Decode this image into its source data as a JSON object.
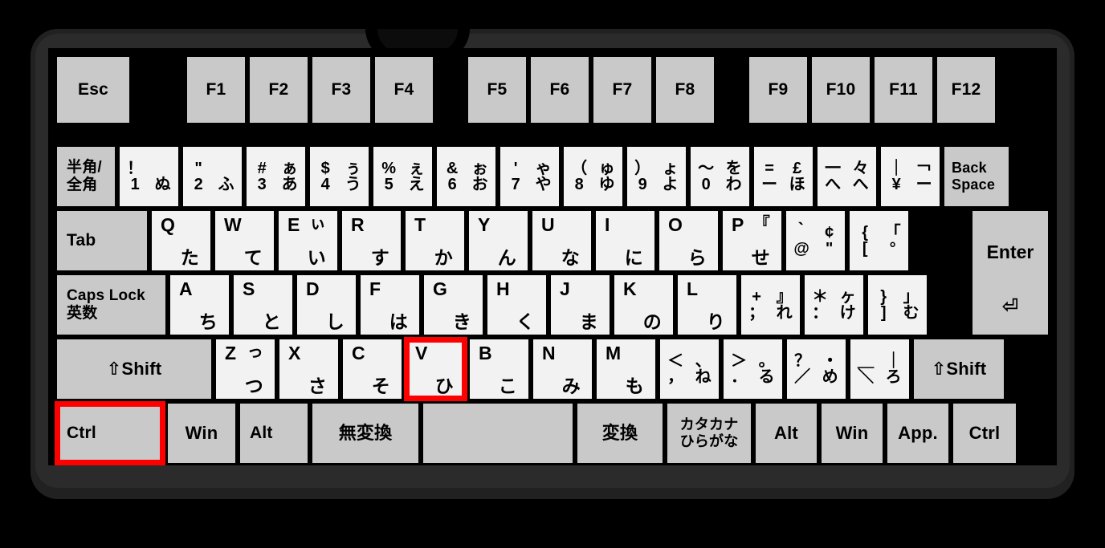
{
  "device": {
    "name": "japanese-jis-keyboard",
    "body_color": "#2b2b2b",
    "key_color": "#c9c9c9",
    "alpha_key_color": "#f2f2f2",
    "highlight_color": "#ff0000"
  },
  "highlighted_keys": [
    "Ctrl",
    "V"
  ],
  "rows": {
    "function_row": [
      {
        "id": "esc",
        "label": "Esc"
      },
      {
        "id": "f1",
        "label": "F1"
      },
      {
        "id": "f2",
        "label": "F2"
      },
      {
        "id": "f3",
        "label": "F3"
      },
      {
        "id": "f4",
        "label": "F4"
      },
      {
        "id": "f5",
        "label": "F5"
      },
      {
        "id": "f6",
        "label": "F6"
      },
      {
        "id": "f7",
        "label": "F7"
      },
      {
        "id": "f8",
        "label": "F8"
      },
      {
        "id": "f9",
        "label": "F9"
      },
      {
        "id": "f10",
        "label": "F10"
      },
      {
        "id": "f11",
        "label": "F11"
      },
      {
        "id": "f12",
        "label": "F12"
      }
    ],
    "number_row": [
      {
        "id": "hankaku-zenkaku",
        "line1": "半角/",
        "line2": "全角"
      },
      {
        "id": "digit-1",
        "tl": "！",
        "tr": "",
        "bl": "1",
        "br": "ぬ"
      },
      {
        "id": "digit-2",
        "tl": "\"",
        "tr": "",
        "bl": "2",
        "br": "ふ"
      },
      {
        "id": "digit-3",
        "tl": "#",
        "tr": "ぁ",
        "bl": "3",
        "br": "あ"
      },
      {
        "id": "digit-4",
        "tl": "$",
        "tr": "ぅ",
        "bl": "4",
        "br": "う"
      },
      {
        "id": "digit-5",
        "tl": "%",
        "tr": "ぇ",
        "bl": "5",
        "br": "え"
      },
      {
        "id": "digit-6",
        "tl": "&",
        "tr": "ぉ",
        "bl": "6",
        "br": "お"
      },
      {
        "id": "digit-7",
        "tl": "'",
        "tr": "ゃ",
        "bl": "7",
        "br": "や"
      },
      {
        "id": "digit-8",
        "tl": "（",
        "tr": "ゅ",
        "bl": "8",
        "br": "ゆ"
      },
      {
        "id": "digit-9",
        "tl": "）",
        "tr": "ょ",
        "bl": "9",
        "br": "よ"
      },
      {
        "id": "digit-0",
        "tl": "〜",
        "tr": "を",
        "bl": "0",
        "br": "わ"
      },
      {
        "id": "minus",
        "tl": "=",
        "tr": "£",
        "bl": "ー",
        "br": "ほ"
      },
      {
        "id": "caret",
        "tl": "一",
        "tr": "々",
        "bl": "へ",
        "br": "へ"
      },
      {
        "id": "yen",
        "tl": "｜",
        "tr": "￢",
        "bl": "¥",
        "br": "ー"
      },
      {
        "id": "backspace",
        "line1": "Back",
        "line2": "Space"
      }
    ],
    "top_row": [
      {
        "id": "tab",
        "label": "Tab"
      },
      {
        "id": "key-q",
        "latin": "Q",
        "kana": "た"
      },
      {
        "id": "key-w",
        "latin": "W",
        "kana": "て"
      },
      {
        "id": "key-e",
        "latin": "E",
        "kana": "い",
        "kana_small": "ぃ"
      },
      {
        "id": "key-r",
        "latin": "R",
        "kana": "す"
      },
      {
        "id": "key-t",
        "latin": "T",
        "kana": "か"
      },
      {
        "id": "key-y",
        "latin": "Y",
        "kana": "ん"
      },
      {
        "id": "key-u",
        "latin": "U",
        "kana": "な"
      },
      {
        "id": "key-i",
        "latin": "I",
        "kana": "に"
      },
      {
        "id": "key-o",
        "latin": "O",
        "kana": "ら"
      },
      {
        "id": "key-p",
        "latin": "P",
        "kana": "せ",
        "kana_small": "『"
      },
      {
        "id": "at",
        "tl": "｀",
        "tr": "¢",
        "bl": "@",
        "br": "\""
      },
      {
        "id": "bracket-left",
        "tl": "{",
        "tr": "「",
        "bl": "[",
        "br": "°"
      }
    ],
    "home_row": [
      {
        "id": "caps-lock",
        "line1": "Caps Lock",
        "line2": "英数"
      },
      {
        "id": "key-a",
        "latin": "A",
        "kana": "ち"
      },
      {
        "id": "key-s",
        "latin": "S",
        "kana": "と"
      },
      {
        "id": "key-d",
        "latin": "D",
        "kana": "し"
      },
      {
        "id": "key-f",
        "latin": "F",
        "kana": "は"
      },
      {
        "id": "key-g",
        "latin": "G",
        "kana": "き"
      },
      {
        "id": "key-h",
        "latin": "H",
        "kana": "く"
      },
      {
        "id": "key-j",
        "latin": "J",
        "kana": "ま"
      },
      {
        "id": "key-k",
        "latin": "K",
        "kana": "の"
      },
      {
        "id": "key-l",
        "latin": "L",
        "kana": "り"
      },
      {
        "id": "semicolon",
        "tl": "+",
        "tr": "』",
        "bl": "；",
        "br": "れ"
      },
      {
        "id": "colon",
        "tl": "＊",
        "tr": "ヶ",
        "bl": "：",
        "br": "け"
      },
      {
        "id": "bracket-right",
        "tl": "}",
        "tr": "」",
        "bl": "]",
        "br": "む"
      }
    ],
    "bottom_letter_row": [
      {
        "id": "shift-left",
        "label": "⇧Shift"
      },
      {
        "id": "key-z",
        "latin": "Z",
        "kana": "つ",
        "kana_small": "っ"
      },
      {
        "id": "key-x",
        "latin": "X",
        "kana": "さ"
      },
      {
        "id": "key-c",
        "latin": "C",
        "kana": "そ"
      },
      {
        "id": "key-v",
        "latin": "V",
        "kana": "ひ"
      },
      {
        "id": "key-b",
        "latin": "B",
        "kana": "こ"
      },
      {
        "id": "key-n",
        "latin": "N",
        "kana": "み"
      },
      {
        "id": "key-m",
        "latin": "M",
        "kana": "も"
      },
      {
        "id": "comma",
        "tl": "＜",
        "tr": "、",
        "bl": "，",
        "br": "ね"
      },
      {
        "id": "period",
        "tl": "＞",
        "tr": "。",
        "bl": "．",
        "br": "る"
      },
      {
        "id": "slash",
        "tl": "？",
        "tr": "・",
        "bl": "／",
        "br": "め"
      },
      {
        "id": "backslash",
        "tl": "＿",
        "tr": "｜",
        "bl": "＼",
        "br": "ろ"
      },
      {
        "id": "shift-right",
        "label": "⇧Shift"
      }
    ],
    "modifier_row": [
      {
        "id": "ctrl-left",
        "label": "Ctrl"
      },
      {
        "id": "win-left",
        "label": "Win"
      },
      {
        "id": "alt-left",
        "label": "Alt"
      },
      {
        "id": "muhenkan",
        "label": "無変換"
      },
      {
        "id": "space",
        "label": ""
      },
      {
        "id": "henkan",
        "label": "変換"
      },
      {
        "id": "katakana-hiragana",
        "line1": "カタカナ",
        "line2": "ひらがな"
      },
      {
        "id": "alt-right",
        "label": "Alt"
      },
      {
        "id": "win-right",
        "label": "Win"
      },
      {
        "id": "app",
        "label": "App."
      },
      {
        "id": "ctrl-right",
        "label": "Ctrl"
      }
    ],
    "enter": {
      "id": "enter",
      "label": "Enter",
      "arrow": "⏎"
    }
  }
}
